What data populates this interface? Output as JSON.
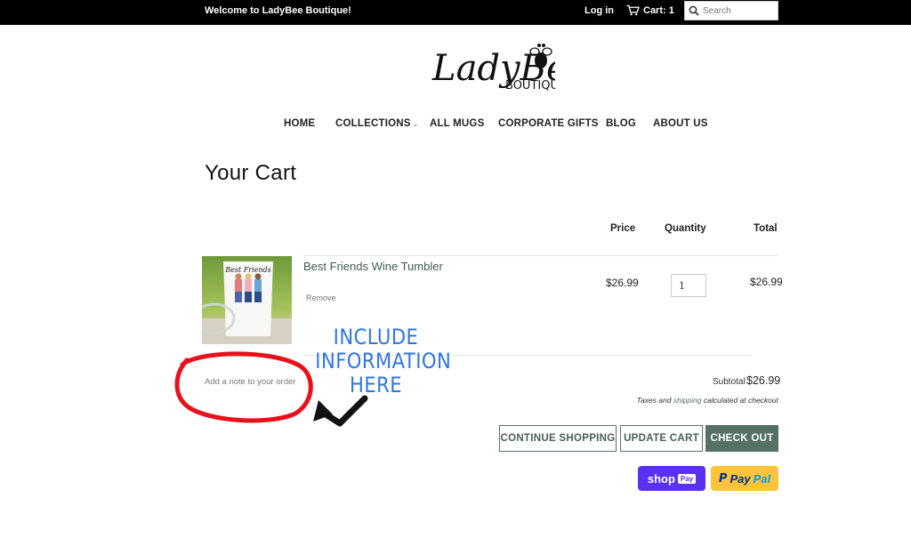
{
  "topbar": {
    "welcome": "Welcome to LadyBee Boutique!",
    "login": "Log in",
    "cart": "Cart: 1",
    "search_placeholder": "Search"
  },
  "brand": {
    "logo_script": "LadyBee",
    "logo_sub": "BOUTIQUE"
  },
  "nav": {
    "items": [
      {
        "label": "HOME"
      },
      {
        "label": "COLLECTIONS",
        "has_dropdown": true,
        "chevron": "⌄"
      },
      {
        "label": "ALL MUGS"
      },
      {
        "label": "CORPORATE GIFTS"
      },
      {
        "label": "BLOG"
      },
      {
        "label": "ABOUT US"
      }
    ]
  },
  "cart": {
    "title": "Your Cart",
    "columns": {
      "price": "Price",
      "quantity": "Quantity",
      "total": "Total"
    },
    "items": [
      {
        "title": "Best Friends Wine Tumbler",
        "thumb_text": "Best Friends",
        "remove_label": "Remove",
        "price": "$26.99",
        "quantity": "1",
        "total": "$26.99"
      }
    ],
    "note_label": "Add a note to your order",
    "subtotal_label": "Subtotal",
    "subtotal_value": "$26.99",
    "tax_note_prefix": "Taxes and",
    "tax_note_link": "shipping",
    "tax_note_suffix": "calculated at checkout",
    "buttons": {
      "continue": "CONTINUE SHOPPING",
      "update": "UPDATE CART",
      "checkout": "CHECK OUT"
    },
    "express": {
      "shoppay_word": "shop",
      "shoppay_badge": "Pay",
      "paypal_a": "Pay",
      "paypal_b": "Pal"
    }
  },
  "annotation": {
    "lines": [
      "INCLUDE",
      "INFORMATION",
      "HERE"
    ],
    "color": "#2f76df",
    "circle_color": "#e8101a"
  },
  "colors": {
    "accent": "#557164",
    "link": "#3f5a50",
    "topbar": "#000000"
  }
}
